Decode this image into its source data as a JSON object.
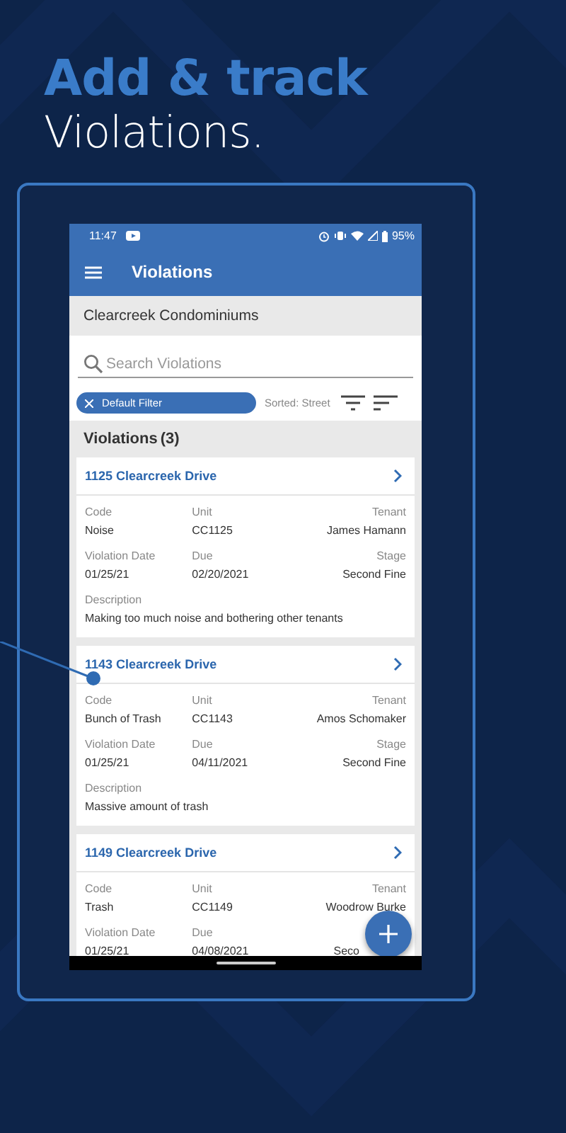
{
  "headline": {
    "title": "Add & track",
    "subtitle": "Violations."
  },
  "status_bar": {
    "time": "11:47",
    "battery": "95%"
  },
  "app_bar": {
    "title": "Violations"
  },
  "property": "Clearcreek Condominiums",
  "search": {
    "placeholder": "Search Violations"
  },
  "filter": {
    "chip": "Default Filter",
    "sort": "Sorted: Street"
  },
  "list": {
    "title": "Violations",
    "count": "(3)"
  },
  "violations": [
    {
      "address": "1125 Clearcreek Drive",
      "fields": [
        {
          "label": "Code",
          "value": "Noise"
        },
        {
          "label": "Unit",
          "value": "CC1125"
        },
        {
          "label": "Tenant",
          "value": "James Hamann"
        },
        {
          "label": "Violation Date",
          "value": "01/25/21"
        },
        {
          "label": "Due",
          "value": "02/20/2021"
        },
        {
          "label": "Stage",
          "value": "Second Fine"
        }
      ],
      "description": {
        "label": "Description",
        "value": "Making too much noise and bothering other tenants"
      }
    },
    {
      "address": "1143 Clearcreek Drive",
      "fields": [
        {
          "label": "Code",
          "value": "Bunch of Trash"
        },
        {
          "label": "Unit",
          "value": "CC1143"
        },
        {
          "label": "Tenant",
          "value": "Amos Schomaker"
        },
        {
          "label": "Violation Date",
          "value": "01/25/21"
        },
        {
          "label": "Due",
          "value": "04/11/2021"
        },
        {
          "label": "Stage",
          "value": "Second Fine"
        }
      ],
      "description": {
        "label": "Description",
        "value": "Massive amount of trash"
      }
    },
    {
      "address": "1149 Clearcreek Drive",
      "fields": [
        {
          "label": "Code",
          "value": "Trash"
        },
        {
          "label": "Unit",
          "value": "CC1149"
        },
        {
          "label": "Tenant",
          "value": "Woodrow Burke"
        },
        {
          "label": "Violation Date",
          "value": "01/25/21"
        },
        {
          "label": "Due",
          "value": "04/08/2021"
        },
        {
          "value": "Seco"
        }
      ]
    }
  ]
}
